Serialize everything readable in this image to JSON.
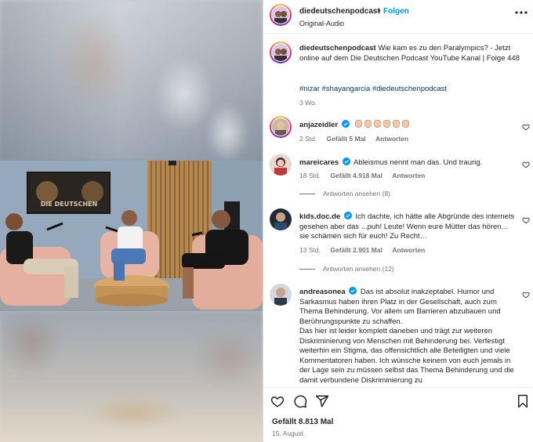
{
  "header": {
    "username": "diedeutschenpodcast",
    "separator": "•",
    "follow_label": "Folgen",
    "audio_label": "Original-Audio"
  },
  "caption": {
    "username": "diedeutschenpodcast",
    "text": "Wie kam es zu den Paralympics? - Jetzt online auf dem Die Deutschen Podcast YouTube Kanal | Folge 448",
    "hashtags": "#nizar #shayangarcia #diedeutschenpodcast",
    "age": "3 Wo."
  },
  "comments": [
    {
      "username": "anjazeidler",
      "verified": true,
      "text": "",
      "emoji": "clapping-hands x6",
      "age": "2 Std.",
      "likes": "Gefällt 5 Mal",
      "reply_label": "Antworten",
      "view_replies": ""
    },
    {
      "username": "mareicares",
      "verified": true,
      "text": "Ableismus nennt man das. Und traurig.",
      "age": "18 Std.",
      "likes": "Gefällt 4.918 Mal",
      "reply_label": "Antworten",
      "view_replies": "Antworten ansehen (8)"
    },
    {
      "username": "kids.doc.de",
      "verified": true,
      "text": "Ich dachte, ich hätte alle Abgründe des internets gesehen aber das ...puh! Leute! Wenn eure Mütter das hören… sie schämen sich für euch! Zu Recht…",
      "age": "13 Std.",
      "likes": "Gefällt 2.901 Mal",
      "reply_label": "Antworten",
      "view_replies": "Antworten ansehen (12)"
    },
    {
      "username": "andreasonea",
      "verified": true,
      "text": "Das ist absolut inakzeptabel. Humor und Sarkasmus haben ihren Platz in der Gesellschaft, auch zum Thema Behinderung. Vor allem um Barrieren abzubauen und Berührungspunkte zu schaffen.",
      "text2": "Das hier ist leider komplett daneben und trägt zur weiteren Diskriminierung von Menschen mit Behinderung bei. Verfestigt weiterhin ein Stigma, das offensichtlich alle Beteiligten und viele Kommentatoren haben. Ich wünsche keinem von euch jemals in der Lage sein zu müssen selbst das Thema Behinderung und die damit verbundene Diskriminierung zu"
    }
  ],
  "footer": {
    "likes": "Gefällt 8.813 Mal",
    "date": "15. August"
  },
  "video": {
    "poster_text": "DIE DEUTSCHEN"
  },
  "icons": {
    "more": "more-horizontal-icon",
    "heart": "heart-icon",
    "comment": "comment-icon",
    "share": "share-icon",
    "bookmark": "bookmark-icon",
    "verified": "verified-badge-icon"
  },
  "colors": {
    "accent": "#0095f6",
    "verified": "#0095f6",
    "text": "#262626",
    "muted": "#737373",
    "hashtag": "#00376b"
  }
}
